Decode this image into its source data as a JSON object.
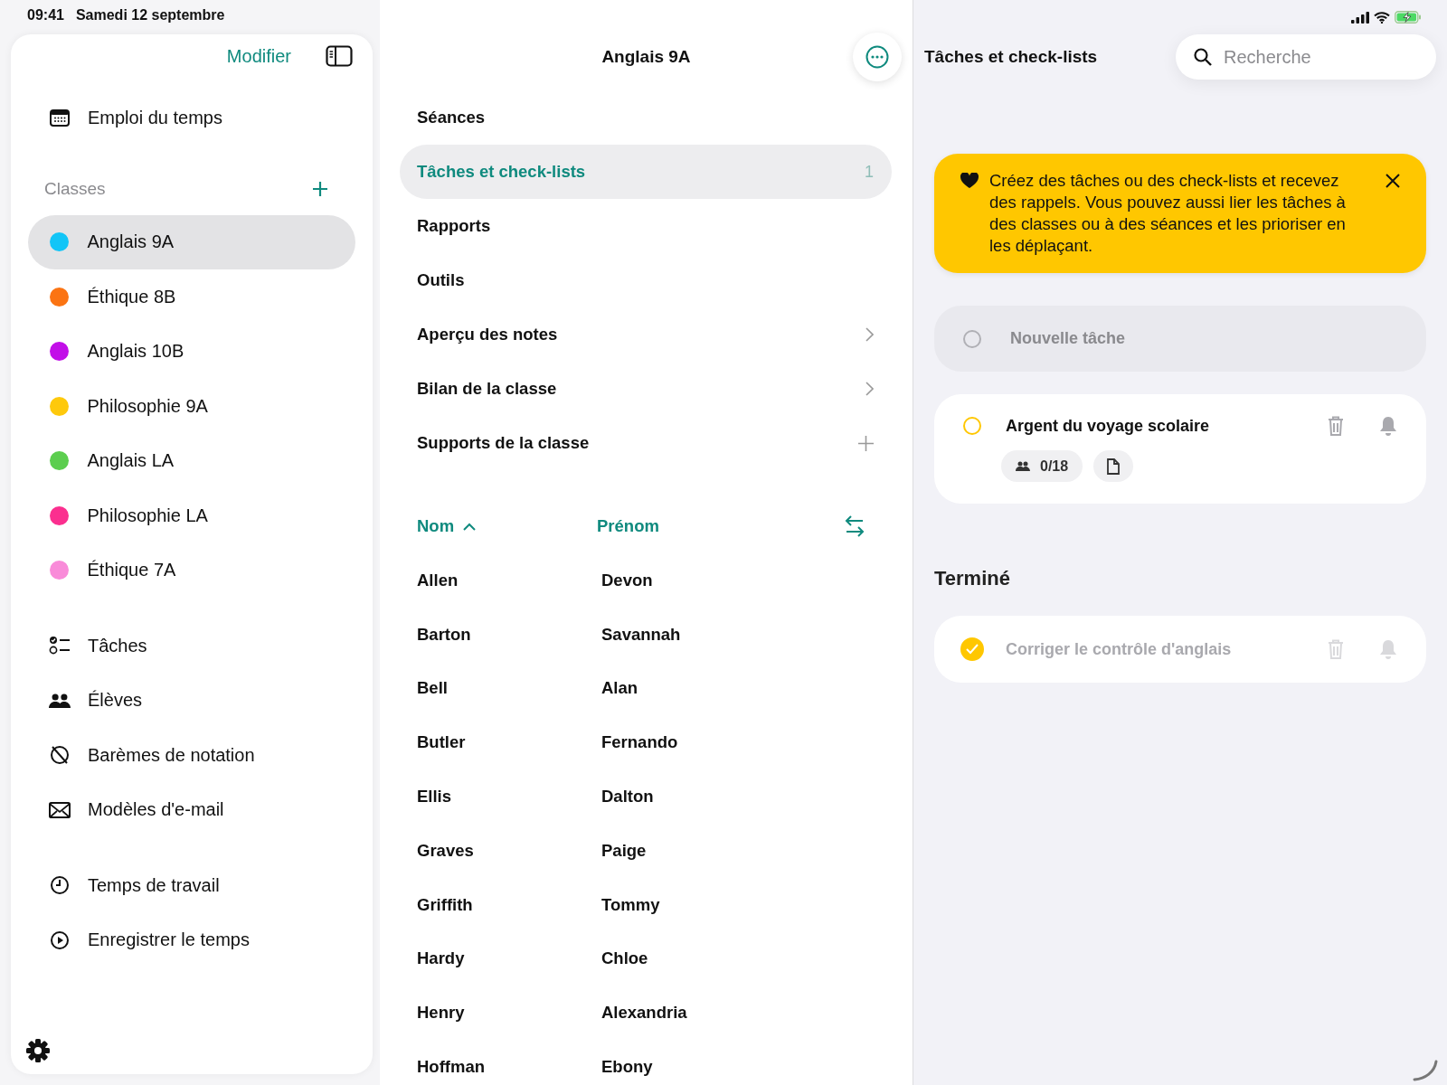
{
  "status_bar": {
    "time": "09:41",
    "date": "Samedi 12 septembre"
  },
  "sidebar": {
    "edit_label": "Modifier",
    "timetable": "Emploi du temps",
    "classes_header": "Classes",
    "classes": [
      {
        "label": "Anglais 9A",
        "color": "#12c5f7",
        "selected": true
      },
      {
        "label": "Éthique 8B",
        "color": "#fb7413",
        "selected": false
      },
      {
        "label": "Anglais 10B",
        "color": "#c20fe8",
        "selected": false
      },
      {
        "label": "Philosophie 9A",
        "color": "#fec90c",
        "selected": false
      },
      {
        "label": "Anglais LA",
        "color": "#5cce4f",
        "selected": false
      },
      {
        "label": "Philosophie LA",
        "color": "#fb2f8f",
        "selected": false
      },
      {
        "label": "Éthique 7A",
        "color": "#f98bd9",
        "selected": false
      }
    ],
    "nav": [
      "Tâches",
      "Élèves",
      "Barèmes de notation",
      "Modèles d'e-mail"
    ],
    "time_nav": [
      "Temps de travail",
      "Enregistrer le temps"
    ]
  },
  "class_view": {
    "title": "Anglais 9A",
    "menu": [
      {
        "label": "Séances",
        "selected": false,
        "kind": "plain"
      },
      {
        "label": "Tâches et check-lists",
        "selected": true,
        "kind": "plain",
        "count": "1"
      },
      {
        "label": "Rapports",
        "selected": false,
        "kind": "plain"
      },
      {
        "label": "Outils",
        "selected": false,
        "kind": "plain"
      },
      {
        "label": "Aperçu des notes",
        "selected": false,
        "kind": "chevron"
      },
      {
        "label": "Bilan de la classe",
        "selected": false,
        "kind": "chevron"
      },
      {
        "label": "Supports de la classe",
        "selected": false,
        "kind": "add"
      }
    ],
    "columns": [
      {
        "label": "Nom",
        "sorted": true
      },
      {
        "label": "Prénom",
        "sorted": false
      }
    ],
    "rows": [
      {
        "last": "Allen",
        "first": "Devon"
      },
      {
        "last": "Barton",
        "first": "Savannah"
      },
      {
        "last": "Bell",
        "first": "Alan"
      },
      {
        "last": "Butler",
        "first": "Fernando"
      },
      {
        "last": "Ellis",
        "first": "Dalton"
      },
      {
        "last": "Graves",
        "first": "Paige"
      },
      {
        "last": "Griffith",
        "first": "Tommy"
      },
      {
        "last": "Hardy",
        "first": "Chloe"
      },
      {
        "last": "Henry",
        "first": "Alexandria"
      },
      {
        "last": "Hoffman",
        "first": "Ebony"
      }
    ]
  },
  "tasks_view": {
    "title": "Tâches et check-lists",
    "search": {
      "placeholder": "Recherche"
    },
    "banner": "Créez des tâches ou des check-lists et recevez des rappels. Vous pouvez aussi lier les tâches à des classes ou à des séances et les prioriser en les déplaçant.",
    "new_task": {
      "placeholder": "Nouvelle tâche"
    },
    "tasks": [
      {
        "title": "Argent du voyage scolaire",
        "done": false,
        "count": "0/18",
        "attachment": true
      }
    ],
    "done_header": "Terminé",
    "done_tasks": [
      {
        "title": "Corriger le contrôle d'anglais",
        "done": true
      }
    ]
  }
}
